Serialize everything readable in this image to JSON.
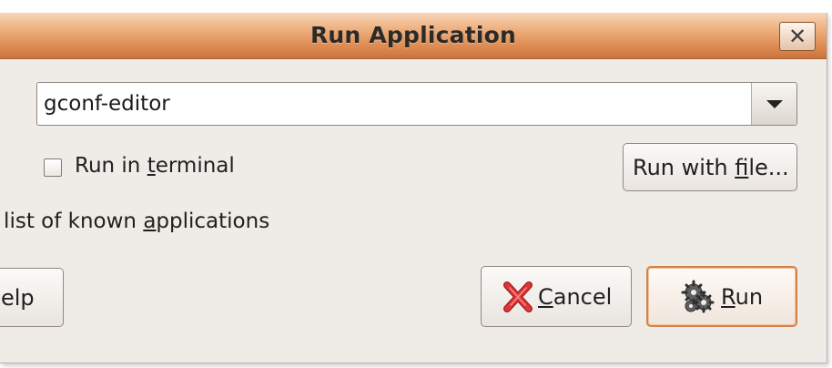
{
  "dialog": {
    "title": "Run Application",
    "close_glyph": "✕"
  },
  "command": {
    "value": "gconf-editor",
    "dropdown_icon": "chevron-down-icon"
  },
  "options": {
    "run_in_terminal": {
      "label_prefix": "Run in ",
      "label_mnemonic": "t",
      "label_suffix": "erminal",
      "checked": false
    },
    "run_with_file": {
      "label_prefix": "Run with ",
      "label_mnemonic": "f",
      "label_suffix": "ile..."
    },
    "known_applications": {
      "label_prefix": "/ list of known ",
      "label_mnemonic": "a",
      "label_suffix": "pplications"
    }
  },
  "buttons": {
    "help": {
      "label": "elp"
    },
    "cancel": {
      "label_mnemonic": "C",
      "label_suffix": "ancel",
      "icon": "cancel-x-icon"
    },
    "run": {
      "label_mnemonic": "R",
      "label_suffix": "un",
      "icon": "gears-icon"
    }
  },
  "colors": {
    "titlebar_accent": "#df8f55",
    "default_button_border": "#d28349",
    "cancel_icon": "#d42a2a"
  }
}
